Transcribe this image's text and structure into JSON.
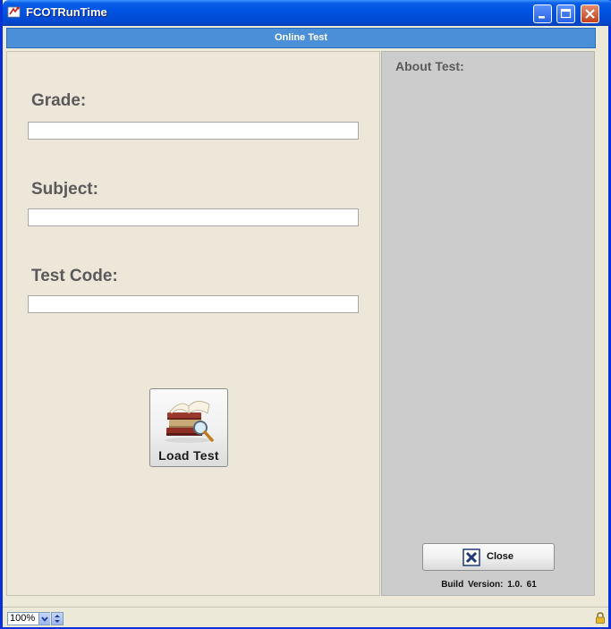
{
  "window": {
    "title": "FCOTRunTime",
    "minimize_icon": "minimize-icon",
    "maximize_icon": "maximize-icon",
    "close_icon": "close-icon"
  },
  "header": {
    "title": "Online Test"
  },
  "form": {
    "grade_label": "Grade:",
    "grade_value": "",
    "subject_label": "Subject:",
    "subject_value": "",
    "test_code_label": "Test Code:",
    "test_code_value": "",
    "load_button_label": "Load Test",
    "load_button_icon": "books-magnifier-icon"
  },
  "about": {
    "label": "About Test:",
    "close_button_label": "Close",
    "close_button_icon": "x-close-icon",
    "build_version": "Build Version:  1.0. 61"
  },
  "status": {
    "zoom": "100%",
    "lock_icon": "lock-icon"
  },
  "colors": {
    "header_blue": "#4b8fd9",
    "left_panel": "#ece7d8",
    "right_panel": "#cccccc",
    "label_gray": "#5a5a5a"
  }
}
